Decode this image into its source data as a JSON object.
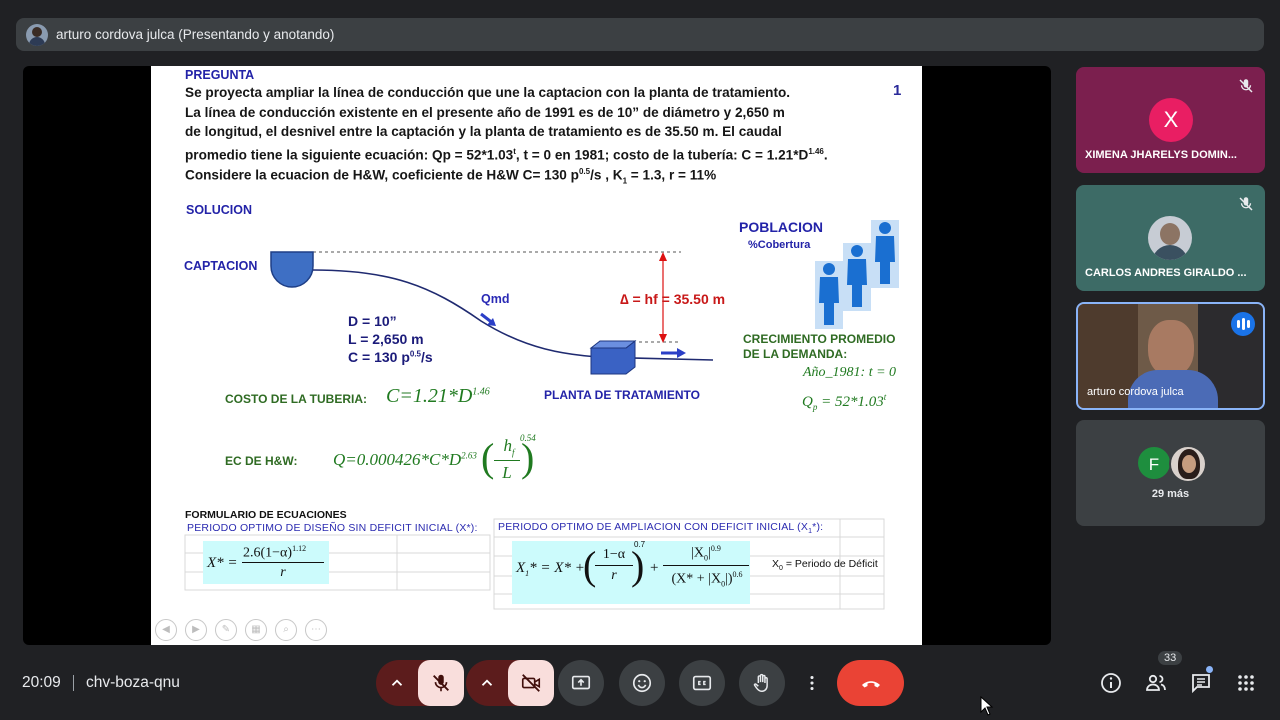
{
  "topbar": {
    "presenter_label": "arturo cordova julca (Presentando y anotando)"
  },
  "slide": {
    "page_number": "1",
    "question_heading": "PREGUNTA",
    "question_lines": [
      "Se proyecta ampliar la línea de conducción que une la captacion con la planta de tratamiento.",
      "La línea de conducción existente en el presente año de 1991 es de 10” de diámetro y 2,650 m",
      "de longitud, el desnivel entre la captación y la planta de tratamiento es de 35.50 m. El caudal",
      "promedio tiene la siguiente ecuación: Qp = 52*1.03",
      "Considere la ecuacion de H&W, coeficiente de H&W C= 130 p"
    ],
    "q4_sup_t": "t",
    "q4_rest": ", t = 0 en 1981; costo de la tubería: C = 1.21*D",
    "q4_sup_146": "1.46",
    "q4_end": ".",
    "q5_sup": "0.5",
    "q5_rest": "/s , K",
    "q5_sub": "1",
    "q5_end": " = 1.3, r = 11%",
    "solution_heading": "SOLUCION",
    "captacion_label": "CAPTACION",
    "qmd_label": "Qmd",
    "d_label": "D = 10”",
    "l_label": "L = 2,650 m",
    "c_label": "C = 130 p",
    "c_sup": "0.5",
    "c_unit": "/s",
    "delta_label": "∆ = hf = 35.50 m",
    "planta_label": "PLANTA DE TRATAMIENTO",
    "poblacion_label": "POBLACION",
    "cobertura_label": "%Cobertura",
    "crecimiento_line1": "CRECIMIENTO PROMEDIO",
    "crecimiento_line2": "DE LA DEMANDA:",
    "anio_formula": "Año_1981: t = 0",
    "qp_formula_main": "Q",
    "qp_formula_sub": "p",
    "qp_formula_rest": " = 52*1.03",
    "qp_formula_sup": "t",
    "costo_label": "COSTO DE LA TUBERIA:",
    "costo_formula": "C=1.21*D",
    "costo_sup": "1.46",
    "hw_label": "EC DE H&W:",
    "hw_formula_left": "Q=0.000426*C*D",
    "hw_sup": "2.63",
    "hw_frac_top": "h",
    "hw_frac_top_sub": "f",
    "hw_frac_bottom": "L",
    "hw_exp": "0.54",
    "formulario_title": "FORMULARIO DE ECUACIONES",
    "periodo1_label": "PERIODO OPTIMO DE DISEÑO SIN DEFICIT INICIAL (X*):",
    "periodo2_label": "PERIODO OPTIMO DE AMPLIACION CON DEFICIT INICIAL (X",
    "periodo2_sub": "1",
    "periodo2_end": "*):",
    "f1_lhs": "X* =",
    "f1_num": "2.6(1−α)",
    "f1_num_exp": "1.12",
    "f1_den": "r",
    "f2_lhs": "X",
    "f2_lhs_sub": "1",
    "f2_lhs_rest": "* = X* +",
    "f2_t1_num": "1−α",
    "f2_t1_den": "r",
    "f2_t1_exp": "0.7",
    "f2_plus": "+",
    "f2_t2_num": "|X",
    "f2_t2_num_sub": "0",
    "f2_t2_num_end": "|",
    "f2_t2_num_exp": "0.9",
    "f2_t2_den": "(X* + |X",
    "f2_t2_den_sub": "0",
    "f2_t2_den_end": "|)",
    "f2_t2_den_exp": "0.6",
    "x0_label": "X",
    "x0_sub": "0",
    "x0_rest": " = Periodo de Déficit"
  },
  "participants": [
    {
      "initial": "X",
      "name": "XIMENA JHARELYS DOMIN...",
      "avatar_color": "#e91e63",
      "bg": "#7b1f4e",
      "muted": true
    },
    {
      "initial": "",
      "name": "CARLOS ANDRES GIRALDO ...",
      "avatar_color": "#b0b8c8",
      "bg": "#3d6b66",
      "muted": true
    },
    {
      "initial": "",
      "name": "arturo cordova julca",
      "bg": "#6e5a48",
      "speaking": true
    },
    {
      "initial": "F",
      "others_count": "29 más",
      "avatar_color": "#1e8e3e",
      "bg": "#3c4043"
    }
  ],
  "bottombar": {
    "time": "20:09",
    "meeting_code": "chv-boza-qnu",
    "people_count": "33"
  },
  "colors": {
    "end_call": "#ea4335",
    "muted_bg": "#f9dedc",
    "muted_group": "#5c1c1c"
  }
}
